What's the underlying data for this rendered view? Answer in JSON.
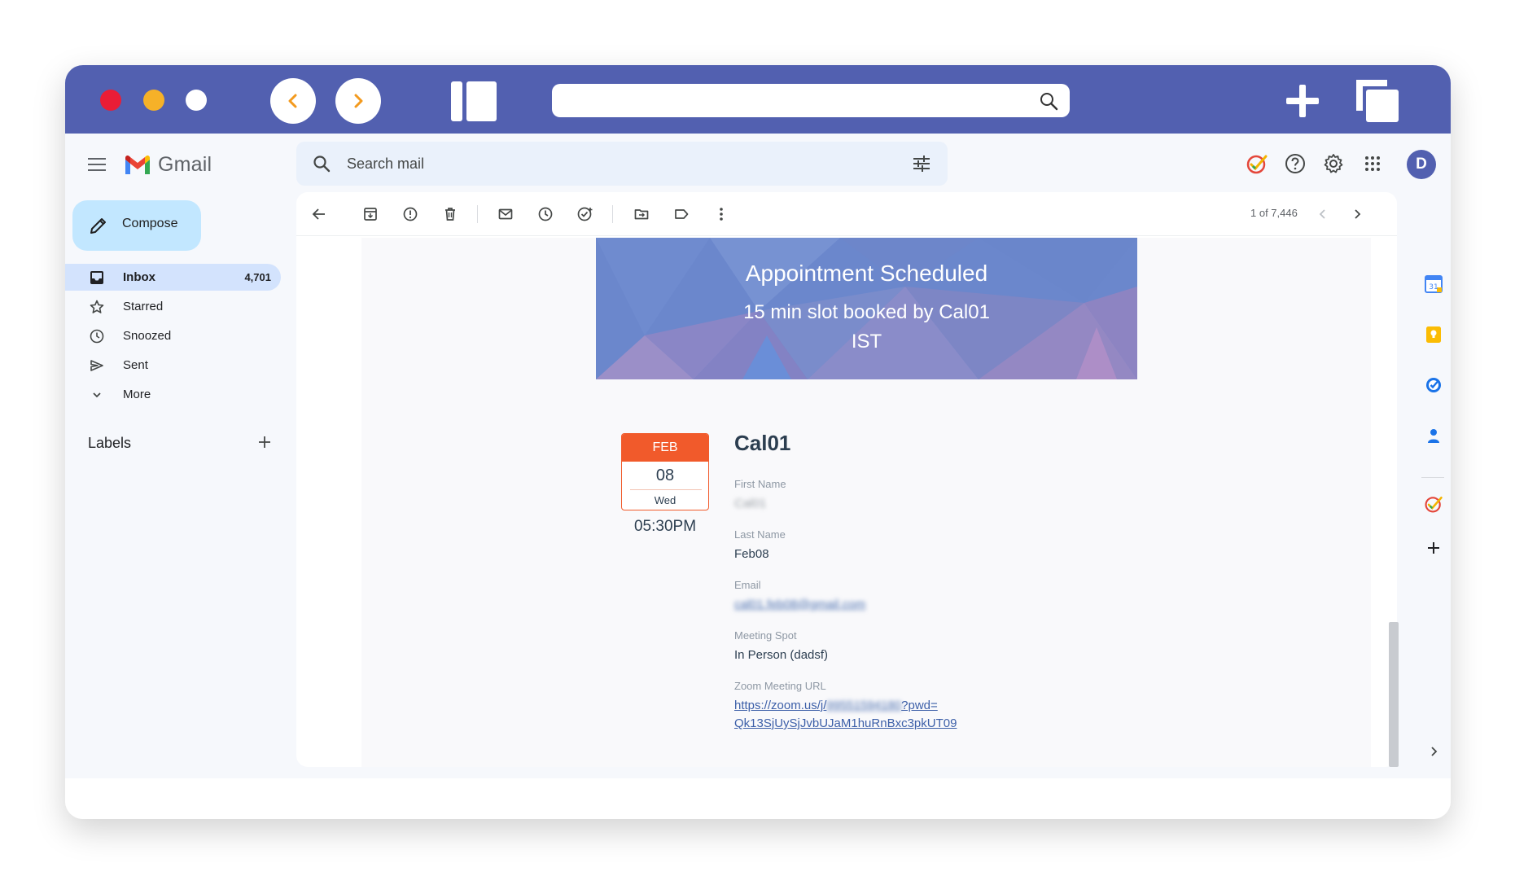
{
  "header": {
    "app_name": "Gmail",
    "search_placeholder": "Search mail",
    "avatar_letter": "D"
  },
  "compose_label": "Compose",
  "nav": {
    "items": [
      {
        "label": "Inbox",
        "count": "4,701",
        "icon": "inbox-icon"
      },
      {
        "label": "Starred",
        "icon": "star-icon"
      },
      {
        "label": "Snoozed",
        "icon": "clock-icon"
      },
      {
        "label": "Sent",
        "icon": "send-icon"
      },
      {
        "label": "More",
        "icon": "chevron-down-icon"
      }
    ],
    "labels_title": "Labels"
  },
  "toolbar": {
    "pager": "1 of 7,446"
  },
  "email": {
    "banner_title": "Appointment Scheduled",
    "banner_line1": "15 min slot booked by Cal01",
    "banner_line2": "IST",
    "cal_month": "FEB",
    "cal_day": "08",
    "cal_dow": "Wed",
    "time": "05:30PM",
    "name": "Cal01",
    "fields": {
      "first_name_label": "First Name",
      "first_name_value": "Cal01",
      "last_name_label": "Last Name",
      "last_name_value": "Feb08",
      "email_label": "Email",
      "email_value": "cal01.feb08@gmail.com",
      "meeting_spot_label": "Meeting Spot",
      "meeting_spot_value": "In Person (dadsf)",
      "zoom_label": "Zoom Meeting URL",
      "zoom_url_part1": "https://zoom.us/j/",
      "zoom_url_blurred": "99551594180",
      "zoom_url_part2": "?pwd=",
      "zoom_url_line2": "Qk13SjUySjJvbUJaM1huRnBxc3pkUT09"
    }
  },
  "colors": {
    "titlebar": "#5260b0",
    "compose_bg": "#c2e7ff",
    "inbox_active": "#d3e3fd",
    "calendar_accent": "#f15a2b",
    "banner": "#6f89cb"
  }
}
